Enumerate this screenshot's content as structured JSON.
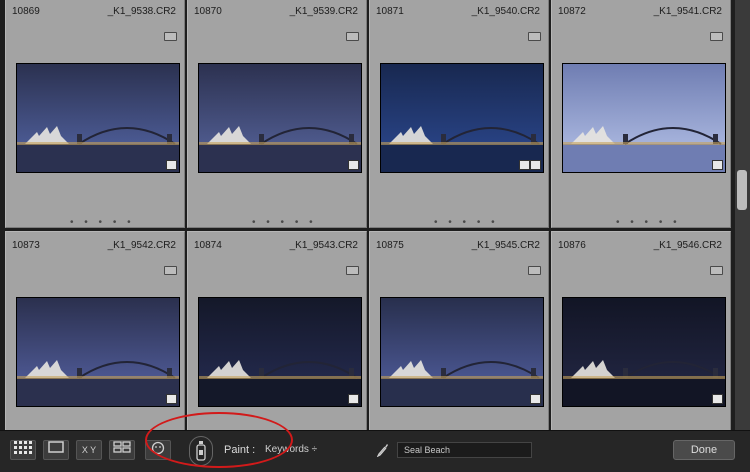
{
  "grid": {
    "cells": [
      {
        "number": "10869",
        "filename": "_K1_9538.CR2",
        "sky": "#4b5a93",
        "tint": "#2b3150"
      },
      {
        "number": "10870",
        "filename": "_K1_9539.CR2",
        "sky": "#4e5a8d",
        "tint": "#2c3150"
      },
      {
        "number": "10871",
        "filename": "_K1_9540.CR2",
        "sky": "#284283",
        "tint": "#182850"
      },
      {
        "number": "10872",
        "filename": "_K1_9541.CR2",
        "sky": "#a6b3dc",
        "tint": "#6f7db2"
      },
      {
        "number": "10873",
        "filename": "_K1_9542.CR2",
        "sky": "#4c5791",
        "tint": "#2b304e"
      },
      {
        "number": "10874",
        "filename": "_K1_9543.CR2",
        "sky": "#22284a",
        "tint": "#141829"
      },
      {
        "number": "10875",
        "filename": "_K1_9545.CR2",
        "sky": "#49558f",
        "tint": "#282f4d"
      },
      {
        "number": "10876",
        "filename": "_K1_9546.CR2",
        "sky": "#20243f",
        "tint": "#121525"
      }
    ],
    "dots": "• • • • •"
  },
  "toolbar": {
    "paint_label": "Paint :",
    "paint_value": "Keywords ÷",
    "keyword_value": "Seal Beach",
    "done_label": "Done",
    "xy_label": "X Y"
  },
  "colors": {
    "annotation": "#d21a1a",
    "cell_bg": "#a3a3a3"
  }
}
